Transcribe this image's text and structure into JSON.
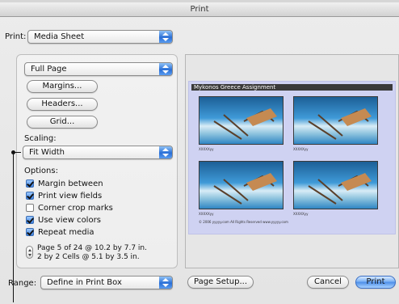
{
  "window": {
    "title": "Print"
  },
  "printer": {
    "label": "Print:",
    "value": "Media Sheet"
  },
  "layout": {
    "page_popup": "Full Page",
    "margins_button": "Margins...",
    "headers_button": "Headers...",
    "grid_button": "Grid..."
  },
  "scaling": {
    "label": "Scaling:",
    "value": "Fit Width"
  },
  "options": {
    "label": "Options:",
    "items": [
      {
        "label": "Margin between",
        "checked": true
      },
      {
        "label": "Print view fields",
        "checked": true
      },
      {
        "label": "Corner crop marks",
        "checked": false
      },
      {
        "label": "Use view colors",
        "checked": true
      },
      {
        "label": "Repeat media",
        "checked": true
      }
    ]
  },
  "page_info": {
    "line1": "Page 5 of 24 @ 10.2 by 7.7 in.",
    "line2": "2 by 2 Cells @ 5.1 by 3.5 in."
  },
  "preview": {
    "sheet_title": "Mykonos Greece Assignment",
    "captions": [
      "XXXXXyy",
      "XXXXXyy",
      "XXXXXyy",
      "XXXXXyy"
    ],
    "footer": "© 2006 yyyyy.com All Rights Reserved www.yyyyy.com"
  },
  "range": {
    "label": "Range:",
    "value": "Define in Print Box"
  },
  "buttons": {
    "page_setup": "Page Setup...",
    "cancel": "Cancel",
    "print": "Print"
  },
  "colors": {
    "accent": "#3d80e0",
    "photo_sky": "#3f9ad8",
    "sheet_bg": "#cfd2f2"
  },
  "icons": {
    "popup_arrows": "updown-arrows-icon",
    "stepper": "stepper-icon"
  }
}
